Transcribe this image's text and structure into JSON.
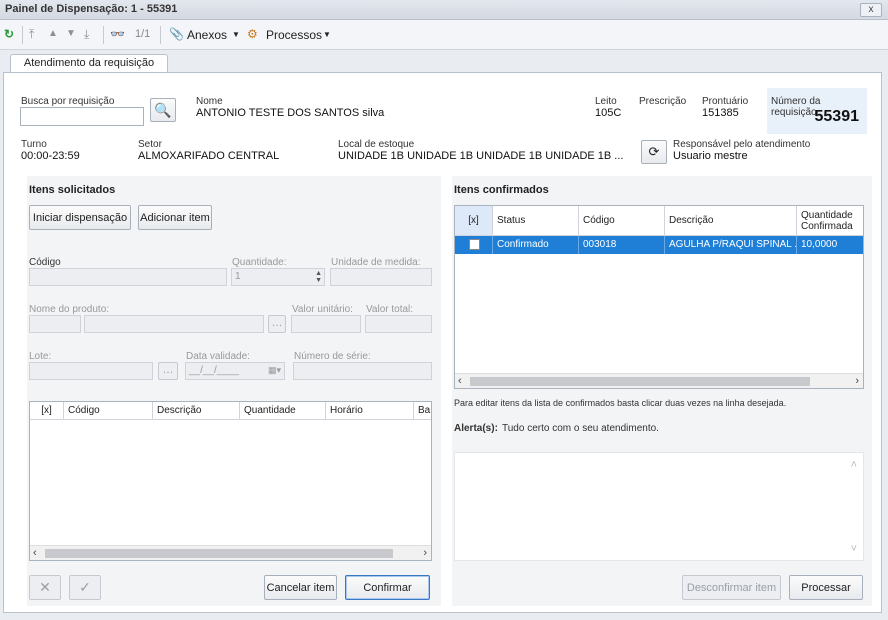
{
  "window": {
    "title": "Painel de Dispensação: 1 - 55391",
    "close": "x"
  },
  "toolbar": {
    "page": "1/1",
    "anexos": "Anexos",
    "processos": "Processos"
  },
  "tab": {
    "label": "Atendimento da requisição"
  },
  "header": {
    "busca_label": "Busca por requisição",
    "nome_label": "Nome",
    "nome_value": "ANTONIO TESTE DOS SANTOS silva",
    "leito_label": "Leito",
    "leito_value": "105C",
    "prescricao_label": "Prescrição",
    "prontuario_label": "Prontuário",
    "prontuario_value": "151385",
    "numero_label": "Número da requisição",
    "numero_value": "55391",
    "turno_label": "Turno",
    "turno_value": "00:00-23:59",
    "setor_label": "Setor",
    "setor_value": "ALMOXARIFADO CENTRAL",
    "local_label": "Local de estoque",
    "local_value": "UNIDADE 1B UNIDADE 1B UNIDADE 1B UNIDADE 1B ...",
    "responsavel_label": "Responsável pelo atendimento",
    "responsavel_value": "Usuario mestre"
  },
  "left": {
    "title": "Itens solicitados",
    "iniciar": "Iniciar dispensação",
    "adicionar": "Adicionar item",
    "codigo_label": "Código",
    "quantidade_label": "Quantidade:",
    "quantidade_value": "1",
    "unidade_label": "Unidade de medida:",
    "nome_produto_label": "Nome do produto:",
    "valor_unitario_label": "Valor unitário:",
    "valor_total_label": "Valor total:",
    "lote_label": "Lote:",
    "data_validade_label": "Data validade:",
    "data_validade_value": "__/__/____",
    "numero_serie_label": "Número de série:",
    "grid_headers": [
      "[x]",
      "Código",
      "Descrição",
      "Quantidade",
      "Horário",
      "Ba"
    ],
    "cancelar": "Cancelar item",
    "confirmar": "Confirmar"
  },
  "right": {
    "title": "Itens confirmados",
    "grid_headers": [
      "[x]",
      "Status",
      "Código",
      "Descrição",
      "Quantidade Confirmada"
    ],
    "rows": [
      {
        "status": "Confirmado",
        "codigo": "003018",
        "descricao": "AGULHA P/RAQUI SPINAL ...",
        "quantidade": "10,0000"
      }
    ],
    "hint": "Para editar itens da lista de confirmados basta clicar duas vezes na linha desejada.",
    "alerta_label": "Alerta(s):",
    "alerta_value": "Tudo certo com o seu atendimento.",
    "desconfirmar": "Desconfirmar item",
    "processar": "Processar"
  },
  "colors": {
    "accent": "#1f7fd6",
    "panel": "#f3f4f6"
  }
}
